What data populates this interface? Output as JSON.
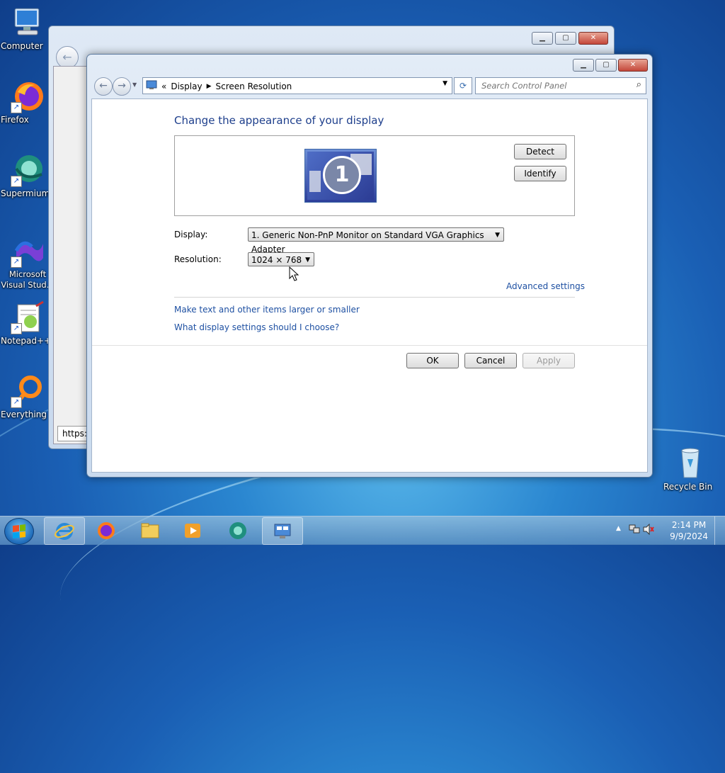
{
  "desktop": {
    "icons": [
      {
        "label": "Computer"
      },
      {
        "label": "Firefox"
      },
      {
        "label": "Supermium"
      },
      {
        "label": "Microsoft Visual Stud..."
      },
      {
        "label": "Notepad++"
      },
      {
        "label": "Everything"
      },
      {
        "label": "Recycle Bin"
      }
    ]
  },
  "back_window": {
    "status_text": "https:/"
  },
  "window": {
    "breadcrumb": [
      "Display",
      "Screen Resolution"
    ],
    "search_placeholder": "Search Control Panel",
    "heading": "Change the appearance of your display",
    "monitor_number": "1",
    "detect_label": "Detect",
    "identify_label": "Identify",
    "display_label": "Display:",
    "display_value": "1. Generic Non-PnP Monitor on Standard VGA Graphics Adapter",
    "resolution_label": "Resolution:",
    "resolution_value": "1024 × 768",
    "advanced_settings": "Advanced settings",
    "link_text_size": "Make text and other items larger or smaller",
    "link_which_settings": "What display settings should I choose?",
    "ok_label": "OK",
    "cancel_label": "Cancel",
    "apply_label": "Apply"
  },
  "taskbar": {
    "items": [
      "internet-explorer",
      "firefox",
      "file-explorer",
      "media-player",
      "supermium",
      "control-panel"
    ],
    "time": "2:14 PM",
    "date": "9/9/2024"
  },
  "colors": {
    "accent": "#1e50a2",
    "heading": "#1e3f8c"
  }
}
